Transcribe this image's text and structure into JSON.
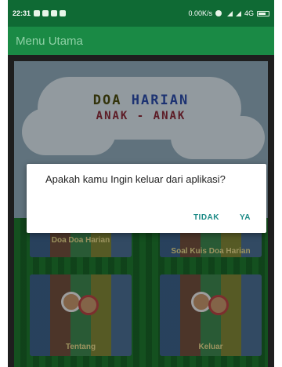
{
  "status_bar": {
    "time": "22:31",
    "network_speed": "0.00K/s",
    "network_type": "4G",
    "icons": [
      "notification-icon",
      "alarm-icon",
      "signal-icon",
      "wifi-icon",
      "battery-icon"
    ]
  },
  "app_bar": {
    "title": "Menu Utama"
  },
  "banner": {
    "line1_left": "DOA",
    "line1_right": "HARIAN",
    "line2": "ANAK - ANAK"
  },
  "menu": {
    "items": [
      {
        "label": "Doa Doa Harian"
      },
      {
        "label": "Soal Kuis Doa Harian"
      },
      {
        "label": "Tentang"
      },
      {
        "label": "Keluar"
      }
    ]
  },
  "dialog": {
    "message": "Apakah kamu Ingin keluar dari aplikasi?",
    "negative_button": "TIDAK",
    "positive_button": "YA"
  },
  "colors": {
    "status_bar": "#0f6a34",
    "app_bar": "#1a8a45",
    "dialog_button": "#1b8a86",
    "menu_label": "#e6d98c"
  }
}
